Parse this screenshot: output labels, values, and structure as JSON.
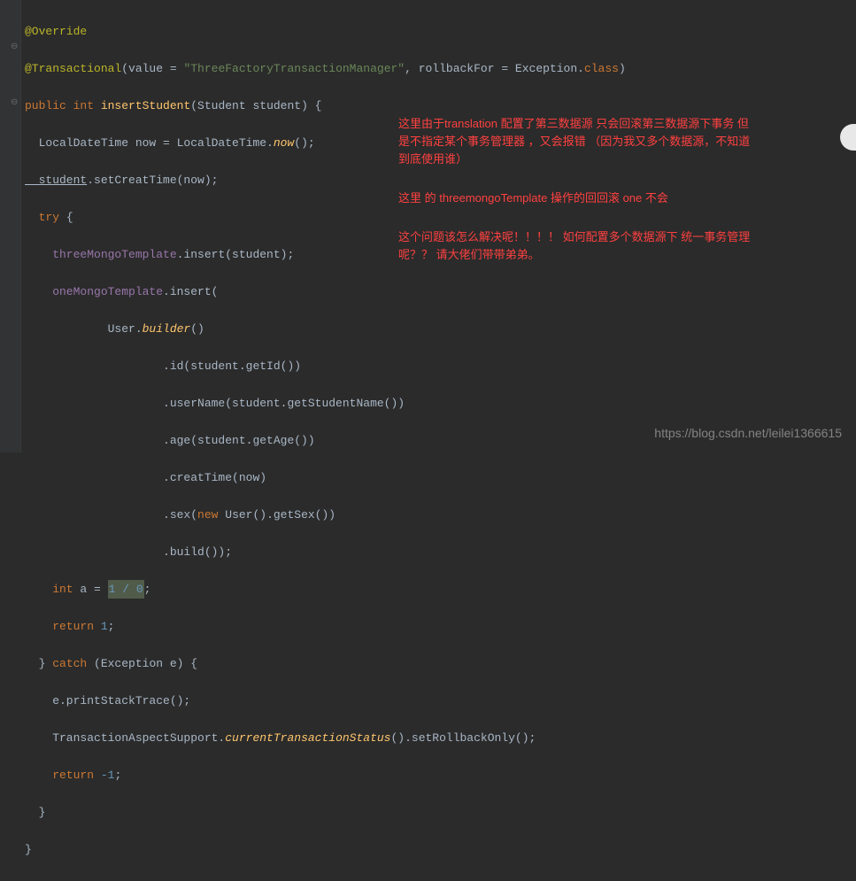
{
  "code": {
    "l1_anno": "@Override",
    "l2_anno": "@Transactional",
    "l2_paren_open": "(",
    "l2_value_key": "value",
    "l2_eq": " = ",
    "l2_str": "\"ThreeFactoryTransactionManager\"",
    "l2_comma": ", ",
    "l2_rollback": "rollbackFor",
    "l2_eq2": " = Exception.",
    "l2_class": "class",
    "l2_end": ")",
    "l3_public": "public int ",
    "l3_method": "insertStudent",
    "l3_params": "(Student student) {",
    "l4": "  LocalDateTime now = LocalDateTime.",
    "l4_now": "now",
    "l4_end": "();",
    "l5_student": "  student",
    "l5_rest": ".setCreatTime(now);",
    "l6_try": "  try ",
    "l6_brace": "{",
    "l7_field": "    threeMongoTemplate",
    "l7_rest": ".insert(student);",
    "l8_field": "    oneMongoTemplate",
    "l8_rest": ".insert(",
    "l9": "            User.",
    "l9_builder": "builder",
    "l9_end": "()",
    "l10": "                    .id(student.getId())",
    "l11": "                    .userName(student.getStudentName())",
    "l12": "                    .age(student.getAge())",
    "l13": "                    .creatTime(now)",
    "l14_pre": "                    .sex(",
    "l14_new": "new ",
    "l14_rest": "User().getSex())",
    "l15": "                    .build());",
    "l16_pre": "    int ",
    "l16_a": "a = ",
    "l16_num": "1 / 0",
    "l16_end": ";",
    "l17_pre": "    return ",
    "l17_num": "1",
    "l17_end": ";",
    "l18_close": "  } ",
    "l18_catch": "catch ",
    "l18_params": "(Exception e) {",
    "l19": "    e.printStackTrace();",
    "l20_pre": "    TransactionAspectSupport.",
    "l20_m1": "currentTransactionStatus",
    "l20_mid": "().setRollbackOnly();",
    "l21_pre": "    return ",
    "l21_num": "-1",
    "l21_end": ";",
    "l22": "  }",
    "l23": "}"
  },
  "annotations": {
    "a1_l1": "这里由于translation 配置了第三数据源 只会回滚第三数据源下事务 但",
    "a1_l2": "是不指定某个事务管理器 ，又会报错  （因为我又多个数据源，不知道",
    "a1_l3": "到底使用谁）",
    "a2": "这里 的 threemongoTemplate 操作的回回滚  one 不会",
    "a3_l1": "这个问题该怎么解决呢！！！！  如何配置多个数据源下 统一事务管理",
    "a3_l2": "呢？？ 请大佬们带带弟弟。"
  },
  "watermark": "https://blog.csdn.net/leilei1366615"
}
